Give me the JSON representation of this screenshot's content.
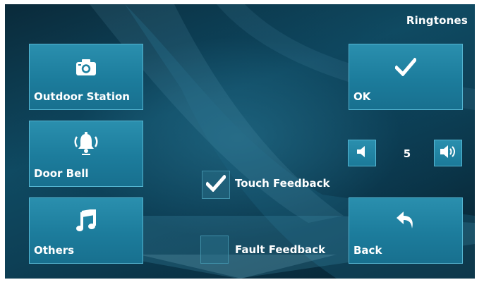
{
  "header": {
    "title": "Ringtones"
  },
  "left_menu": [
    {
      "label": "Outdoor Station",
      "icon": "camera-icon"
    },
    {
      "label": "Door Bell",
      "icon": "bell-icon"
    },
    {
      "label": "Others",
      "icon": "music-note-icon"
    }
  ],
  "actions": {
    "ok_label": "OK",
    "ok_icon": "check-icon",
    "back_label": "Back",
    "back_icon": "back-arrow-icon"
  },
  "volume": {
    "value": "5",
    "down_icon": "volume-down-icon",
    "up_icon": "volume-up-icon"
  },
  "options": [
    {
      "label": "Touch Feedback",
      "checked": true
    },
    {
      "label": "Fault Feedback",
      "checked": false
    }
  ],
  "colors": {
    "background": "#0d3f55",
    "tile": "#1f82a2",
    "text": "#ffffff"
  }
}
